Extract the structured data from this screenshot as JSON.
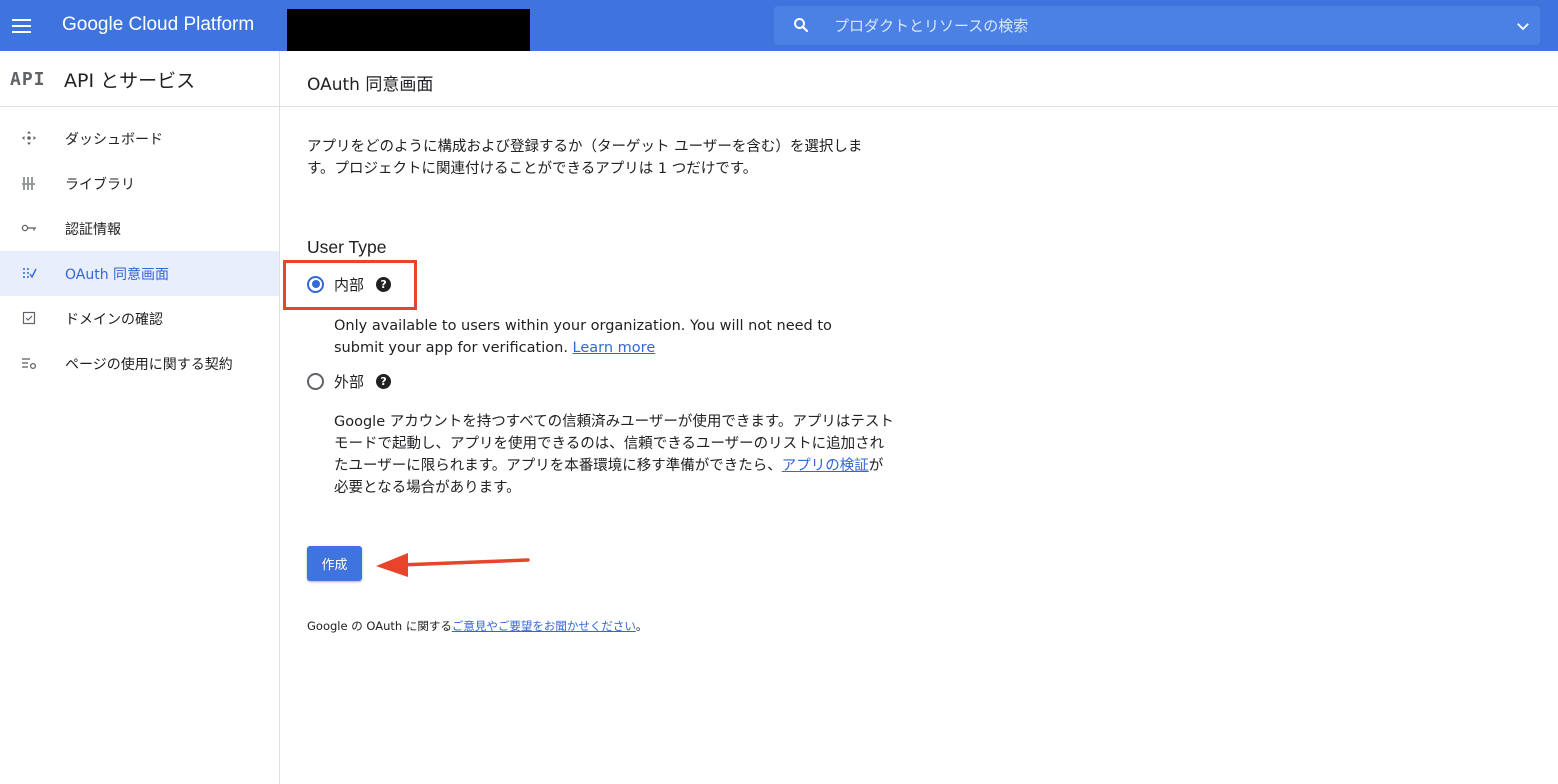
{
  "topbar": {
    "brand": "Google Cloud Platform",
    "search_placeholder": "プロダクトとリソースの検索",
    "search_icon": "search-icon",
    "expand_icon": "chevron-down-icon",
    "bar_color": "#3f74de"
  },
  "nav": {
    "logo": "API",
    "title": "API とサービス",
    "items": [
      {
        "label": "ダッシュボード",
        "icon": "dashboard-icon",
        "active": false
      },
      {
        "label": "ライブラリ",
        "icon": "library-icon",
        "active": false
      },
      {
        "label": "認証情報",
        "icon": "key-icon",
        "active": false
      },
      {
        "label": "OAuth 同意画面",
        "icon": "consent-screen-icon",
        "active": true
      },
      {
        "label": "ドメインの確認",
        "icon": "checkbox-icon",
        "active": false
      },
      {
        "label": "ページの使用に関する契約",
        "icon": "settings-list-icon",
        "active": false
      }
    ]
  },
  "main": {
    "title": "OAuth 同意画面",
    "intro": "アプリをどのように構成および登録するか（ターゲット ユーザーを含む）を選択します。プロジェクトに関連付けることができるアプリは 1 つだけです。",
    "user_type_heading": "User Type",
    "options": [
      {
        "label": "内部",
        "selected": true,
        "desc": "Only available to users within your organization. You will not need to submit your app for verification.",
        "link": "Learn more"
      },
      {
        "label": "外部",
        "selected": false,
        "desc_before": "Google アカウントを持つすべての信頼済みユーザーが使用できます。アプリはテストモードで起動し、アプリを使用できるのは、信頼できるユーザーのリストに追加されたユーザーに限られます。アプリを本番環境に移す準備ができたら、",
        "link": "アプリの検証",
        "desc_after": "が必要となる場合があります。"
      }
    ],
    "create_button": "作成",
    "feedback_before": "Google の OAuth に関する",
    "feedback_link": "ご意見やご要望をお聞かせください",
    "feedback_after": "。"
  },
  "annotations": {
    "highlight_color": "#e8442b"
  }
}
